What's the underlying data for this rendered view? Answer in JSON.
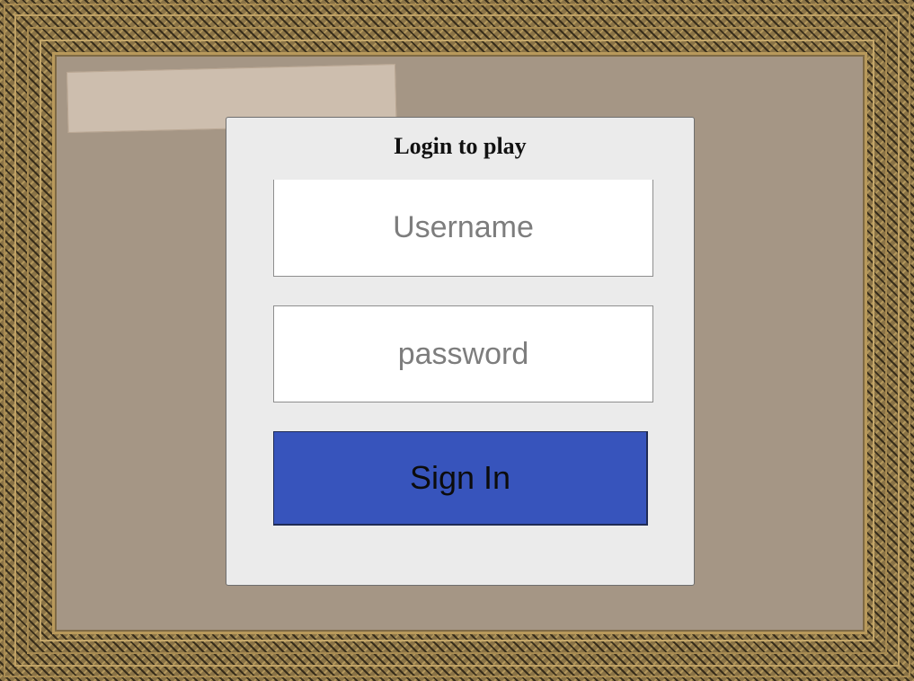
{
  "login": {
    "title": "Login to play",
    "username_placeholder": "Username",
    "username_value": "",
    "password_placeholder": "password",
    "password_value": "",
    "signin_label": "Sign In"
  },
  "colors": {
    "frame": "#8a7346",
    "board": "#a59685",
    "tape": "#cdbeae",
    "dialog": "#ebebeb",
    "signin_button": "#3754bc"
  }
}
